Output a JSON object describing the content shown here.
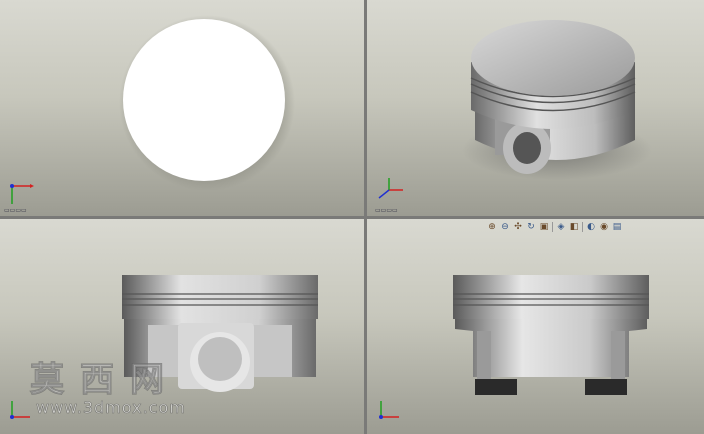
{
  "viewports": [
    {
      "id": "top",
      "view": "top-view"
    },
    {
      "id": "iso",
      "view": "isometric-view"
    },
    {
      "id": "front",
      "view": "front-view"
    },
    {
      "id": "side",
      "view": "side-view"
    }
  ],
  "toolbar": {
    "buttons": [
      {
        "name": "zoom-to-fit-icon",
        "glyph": "⊕"
      },
      {
        "name": "zoom-in-out-icon",
        "glyph": "⊖"
      },
      {
        "name": "pan-icon",
        "glyph": "✣"
      },
      {
        "name": "rotate-icon",
        "glyph": "↻"
      },
      {
        "name": "section-view-icon",
        "glyph": "▣"
      },
      {
        "name": "view-orientation-icon",
        "glyph": "◈"
      },
      {
        "name": "display-style-icon",
        "glyph": "◧"
      },
      {
        "name": "hide-show-icon",
        "glyph": "◐"
      },
      {
        "name": "appearance-icon",
        "glyph": "◉"
      },
      {
        "name": "scene-icon",
        "glyph": "▤"
      }
    ]
  },
  "watermark": {
    "chars": "莫西网",
    "url": "www.3dmox.com"
  },
  "colors": {
    "axis_x": "#d42020",
    "axis_y": "#20a020",
    "axis_z": "#2030d0"
  }
}
